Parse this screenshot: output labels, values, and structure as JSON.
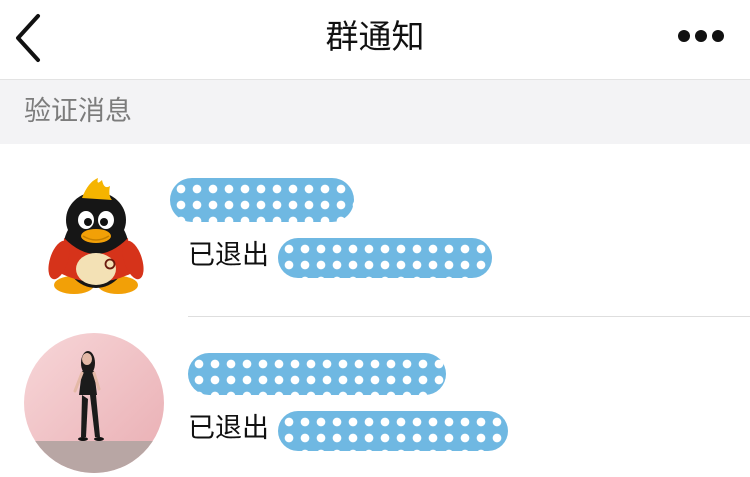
{
  "navbar": {
    "title": "群通知",
    "back_icon": "chevron-left-icon",
    "more_icon": "more-horizontal-icon"
  },
  "section": {
    "title": "验证消息"
  },
  "notifications": [
    {
      "status_text": "已退出",
      "avatar_icon": "qq-penguin-icon"
    },
    {
      "status_text": "已退出",
      "avatar_icon": "user-photo-avatar"
    }
  ],
  "colors": {
    "redaction_blue": "#6fb8e2",
    "section_background": "#f3f3f5",
    "section_text": "#7c7c7c"
  }
}
